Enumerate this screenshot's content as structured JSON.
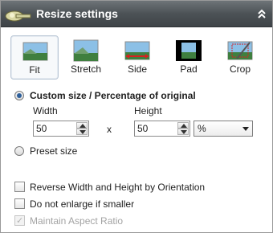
{
  "header": {
    "title": "Resize settings",
    "icon": "ruler-wrench-icon",
    "collapse_icon": "double-chevron-up-icon"
  },
  "modes": [
    {
      "label": "Fit",
      "selected": true
    },
    {
      "label": "Stretch",
      "selected": false
    },
    {
      "label": "Side",
      "selected": false
    },
    {
      "label": "Pad",
      "selected": false
    },
    {
      "label": "Crop",
      "selected": false
    }
  ],
  "custom": {
    "label": "Custom size / Percentage of original",
    "selected": true,
    "width_label": "Width",
    "height_label": "Height",
    "width_value": "50",
    "height_value": "50",
    "separator": "x",
    "unit": "%"
  },
  "preset": {
    "label": "Preset size",
    "selected": false
  },
  "options": [
    {
      "label": "Reverse Width and Height by Orientation",
      "checked": false,
      "enabled": true
    },
    {
      "label": "Do not enlarge if smaller",
      "checked": false,
      "enabled": true
    },
    {
      "label": "Maintain Aspect Ratio",
      "checked": true,
      "enabled": false
    }
  ],
  "colors": {
    "accent": "#2d5f9a",
    "header": "#4c5256"
  }
}
